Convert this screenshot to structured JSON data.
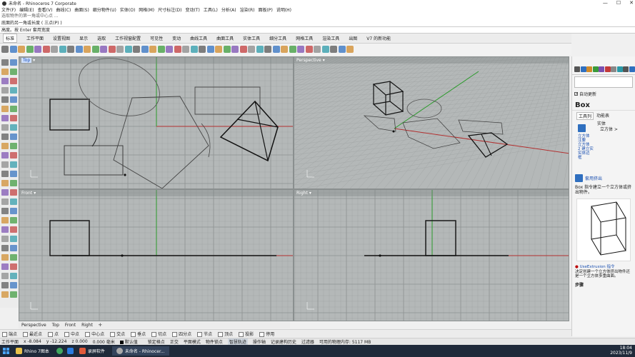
{
  "window": {
    "title": "未命名 - Rhinoceros 7 Corporate",
    "controls": [
      "—",
      "☐",
      "✕"
    ]
  },
  "menu": [
    "文件(F)",
    "编辑(E)",
    "查看(V)",
    "曲线(C)",
    "曲面(S)",
    "细分物件(U)",
    "实体(O)",
    "网格(M)",
    "尺寸标注(D)",
    "变动(T)",
    "工具(L)",
    "分析(A)",
    "渲染(R)",
    "面板(P)",
    "说明(H)"
  ],
  "command": {
    "history": "选取物件的第一角或中心点 ...",
    "prompt": "底面的另一角或长度 ( 三点(P) )",
    "current": "高度。按 Enter 套用宽度",
    "input": ""
  },
  "toolbar_tabs": [
    "标准",
    "工作平面",
    "设置视图",
    "显示",
    "选取",
    "工作视窗配置",
    "可见性",
    "变动",
    "曲线工具",
    "曲面工具",
    "实体工具",
    "细分工具",
    "网格工具",
    "渲染工具",
    "出图",
    "V7 的新功能"
  ],
  "viewports": {
    "top": {
      "label": "Top"
    },
    "perspective": {
      "label": "Perspective"
    },
    "front": {
      "label": "Front"
    },
    "right": {
      "label": "Right"
    }
  },
  "viewport_tabs": [
    "Perspective",
    "Top",
    "Front",
    "Right",
    "✛"
  ],
  "osnaps": [
    "端点",
    "最近点",
    "点",
    "中点",
    "中心点",
    "交点",
    "垂点",
    "切点",
    "四分点",
    "节点",
    "顶点",
    "投影",
    "停用"
  ],
  "status": {
    "plane": "工作平面",
    "x": "x -8.084",
    "y": "y -12.224",
    "z": "z 0.000",
    "unit": "0.000 毫米",
    "layer": "默认值",
    "items": [
      "锁定格点",
      "正交",
      "平面模式",
      "物件锁点",
      "智慧轨迹",
      "操作轴",
      "记录建构历史",
      "过滤器",
      "可用的物理内存: 5117 MB"
    ],
    "active_item": "智慧轨迹"
  },
  "right_panel": {
    "checkbox": "自动更新",
    "help_title": "Box",
    "tab1": "工具列",
    "tab2": "功能表",
    "menu_entries": [
      "实体",
      "立方体 >"
    ],
    "links": [
      "立方体",
      "注要",
      "立方体",
      "2 建立实",
      "实体边",
      "框"
    ],
    "extrude_link": "套用挤出",
    "desc1": "Box 指令建立一个立方体或挤出物件。",
    "use_ext": "UseExtrusion 指令",
    "desc2": "决定创建一个立方体挤出物件还是一个立方体多重曲面。",
    "steps": "步骤"
  },
  "taskbar": {
    "items": [
      "Rhino 7图本",
      "录屏软件",
      "未命名 - Rhinocer..."
    ],
    "time": "18:04",
    "date": "2023/11/9"
  },
  "colors": {
    "viewport_bg": "#b4b8b8",
    "grid_line": "#a3a7a7",
    "x_axis": "#b23030",
    "y_axis": "#2a9a2a",
    "accent": "#1a4fb0"
  }
}
